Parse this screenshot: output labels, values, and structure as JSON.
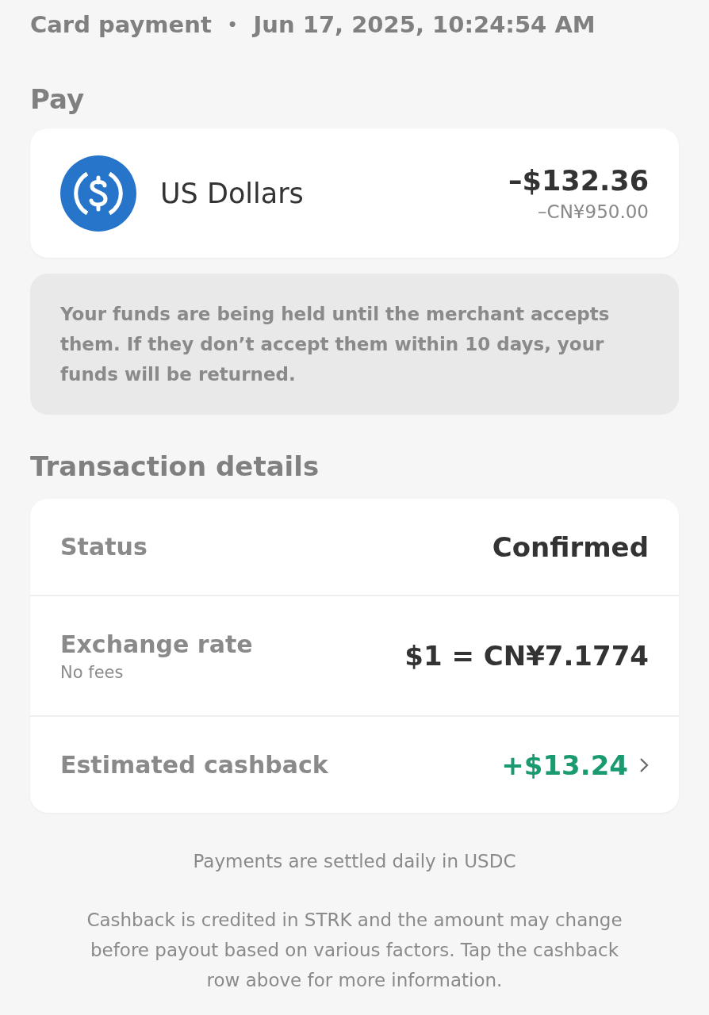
{
  "header": {
    "type": "Card payment",
    "separator": "•",
    "datetime": "Jun 17, 2025, 10:24:54 AM"
  },
  "pay": {
    "title": "Pay",
    "currency": "US Dollars",
    "amount": "–$132.36",
    "local_amount": "–CN¥950.00"
  },
  "notice": "Your funds are being held until the merchant accepts them. If they don’t accept them within 10 days, your funds will be returned.",
  "details": {
    "title": "Transaction details",
    "rows": [
      {
        "kind": "plain",
        "label": "Status",
        "value": "Confirmed"
      },
      {
        "kind": "sub",
        "label": "Exchange rate",
        "sublabel": "No fees",
        "value": "$1 = CN¥7.1774"
      },
      {
        "kind": "link",
        "label": "Estimated cashback",
        "value": "+$13.24"
      }
    ]
  },
  "footer": [
    "Payments are settled daily in USDC",
    "Cashback is credited in STRK and the amount may change before payout based on various factors. Tap the cashback row above for more information."
  ]
}
